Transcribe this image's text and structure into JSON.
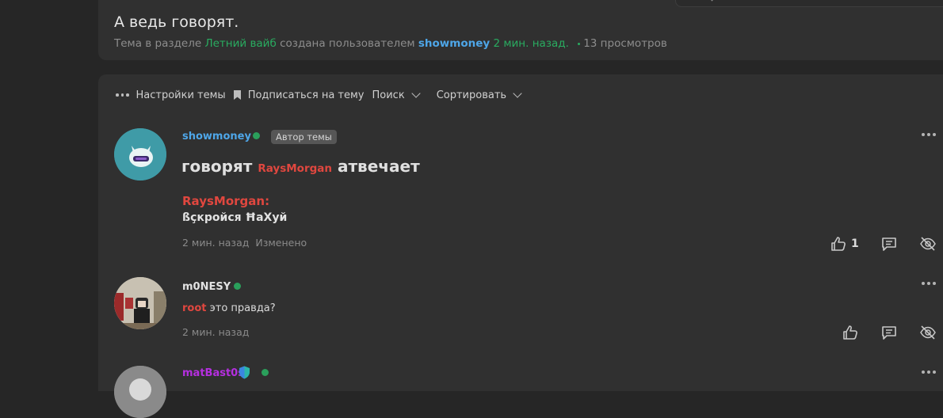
{
  "thread": {
    "title": "А ведь говорят.",
    "meta_prefix": "Тема в разделе",
    "section": "Летний вайб",
    "meta_created": "создана пользователем",
    "author": "showmoney",
    "time": "2 мин. назад.",
    "views": "13 просмотров"
  },
  "toolbar": {
    "settings_label": "Настройки темы",
    "subscribe_label": "Подписаться на тему",
    "search_label": "Поиск",
    "sort_label": "Сортировать"
  },
  "posts": [
    {
      "username": "showmoney",
      "badge": "Автор темы",
      "title_before": "говорят",
      "title_mention": "RaysMorgan",
      "title_after": "атвечает",
      "quote_name": "RaysMorgan:",
      "quote_text": "ßçкройся ĦаХуй",
      "time": "2 мин. назад",
      "edited": "Изменено",
      "likes": "1"
    },
    {
      "username": "m0NESY",
      "mention": "root",
      "text": "это правда?",
      "time": "2 мин. назад"
    },
    {
      "username": "matBast0s"
    }
  ],
  "colors": {
    "green": "#29ac60",
    "link_blue": "#4ea6e8",
    "mention_red": "#e0473f",
    "purple": "#b52fe0"
  }
}
